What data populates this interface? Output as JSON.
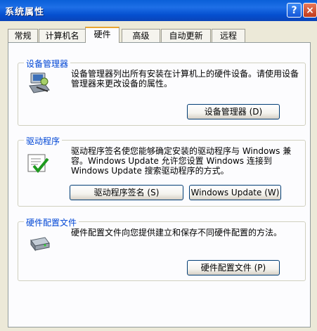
{
  "window": {
    "title": "系统属性",
    "help_glyph": "?",
    "close_glyph": "×"
  },
  "tabs": [
    {
      "label": "常规"
    },
    {
      "label": "计算机名"
    },
    {
      "label": "硬件",
      "active": true
    },
    {
      "label": "高级"
    },
    {
      "label": "自动更新"
    },
    {
      "label": "远程"
    }
  ],
  "device_manager": {
    "title": "设备管理器",
    "description": "设备管理器列出所有安装在计算机上的硬件设备。请使用设备管理器来更改设备的属性。",
    "button": "设备管理器 (D)"
  },
  "drivers": {
    "title": "驱动程序",
    "description": "驱动程序签名使您能够确定安装的驱动程序与 Windows 兼容。Windows Update 允许您设置 Windows 连接到 Windows Update 搜索驱动程序的方式。",
    "signing_button": "驱动程序签名 (S)",
    "update_button": "Windows Update (W)"
  },
  "hardware_profiles": {
    "title": "硬件配置文件",
    "description": "硬件配置文件向您提供建立和保存不同硬件配置的方法。",
    "button": "硬件配置文件 (P)"
  },
  "icons": [
    "device-manager-icon",
    "driver-signing-icon",
    "hardware-profile-icon"
  ]
}
